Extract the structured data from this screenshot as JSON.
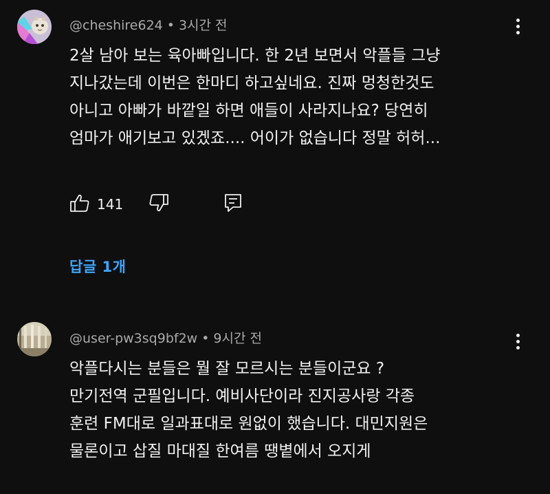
{
  "comments": [
    {
      "author": "@cheshire624",
      "separator": "•",
      "time": "3시간 전",
      "lines": [
        "2살 남아 보는 육아빠입니다. 한 2년 보면서 악플들 그냥",
        "지나갔는데 이번은 한마디 하고싶네요. 진짜 멍청한것도",
        "아니고 아빠가 바깥일 하면 애들이 사라지나요? 당연히",
        "엄마가 애기보고 있겠죠.... 어이가 없습니다 정말 허허..."
      ],
      "likes": "141",
      "replies_label": "답글 1개"
    },
    {
      "author": "@user-pw3sq9bf2w",
      "separator": "•",
      "time": "9시간 전",
      "lines": [
        "악플다시는 분들은 뭘 잘 모르시는 분들이군요 ?",
        "만기전역 군필입니다. 예비사단이라 진지공사랑 각종",
        "훈련 FM대로 일과표대로 원없이 했습니다. 대민지원은",
        "물론이고 삽질 마대질 한여름 땡볕에서 오지게"
      ]
    }
  ],
  "icons": {
    "like": "thumbs-up-icon",
    "dislike": "thumbs-down-icon",
    "reply": "reply-icon",
    "more": "more-vertical-icon"
  },
  "colors": {
    "background": "#0f0f0f",
    "text": "#f1f1f1",
    "meta": "#aaaaaa",
    "link": "#3ea6ff"
  }
}
